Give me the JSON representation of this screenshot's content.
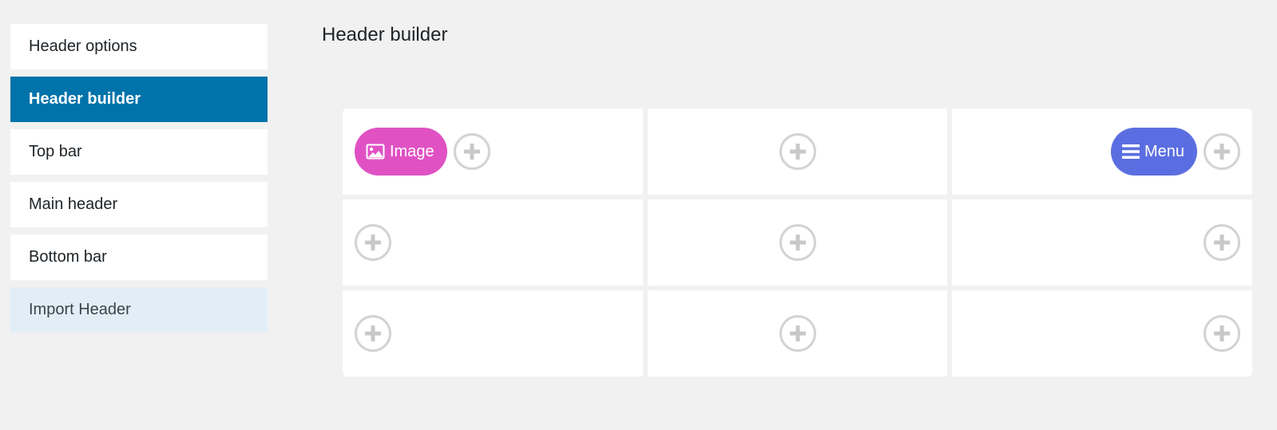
{
  "sidebar": {
    "items": [
      {
        "label": "Header options"
      },
      {
        "label": "Header builder"
      },
      {
        "label": "Top bar"
      },
      {
        "label": "Main header"
      },
      {
        "label": "Bottom bar"
      },
      {
        "label": "Import Header"
      }
    ],
    "active_index": 1
  },
  "main": {
    "title": "Header builder"
  },
  "builder": {
    "elements": {
      "image": {
        "label": "Image",
        "icon": "image-icon",
        "color": "#e052c4"
      },
      "menu": {
        "label": "Menu",
        "icon": "hamburger-icon",
        "color": "#5b6ee1"
      }
    },
    "rows": [
      {
        "name": "top",
        "cells": [
          {
            "position": "left",
            "elements": [
              "Image"
            ]
          },
          {
            "position": "center",
            "elements": []
          },
          {
            "position": "right",
            "elements": [
              "Menu"
            ]
          }
        ]
      },
      {
        "name": "main",
        "cells": [
          {
            "position": "left",
            "elements": []
          },
          {
            "position": "center",
            "elements": []
          },
          {
            "position": "right",
            "elements": []
          }
        ]
      },
      {
        "name": "bottom",
        "cells": [
          {
            "position": "left",
            "elements": []
          },
          {
            "position": "center",
            "elements": []
          },
          {
            "position": "right",
            "elements": []
          }
        ]
      }
    ]
  },
  "colors": {
    "active_sidebar": "#0073aa",
    "import_bg": "#e2eef5",
    "page_bg": "#f1f1f1"
  }
}
